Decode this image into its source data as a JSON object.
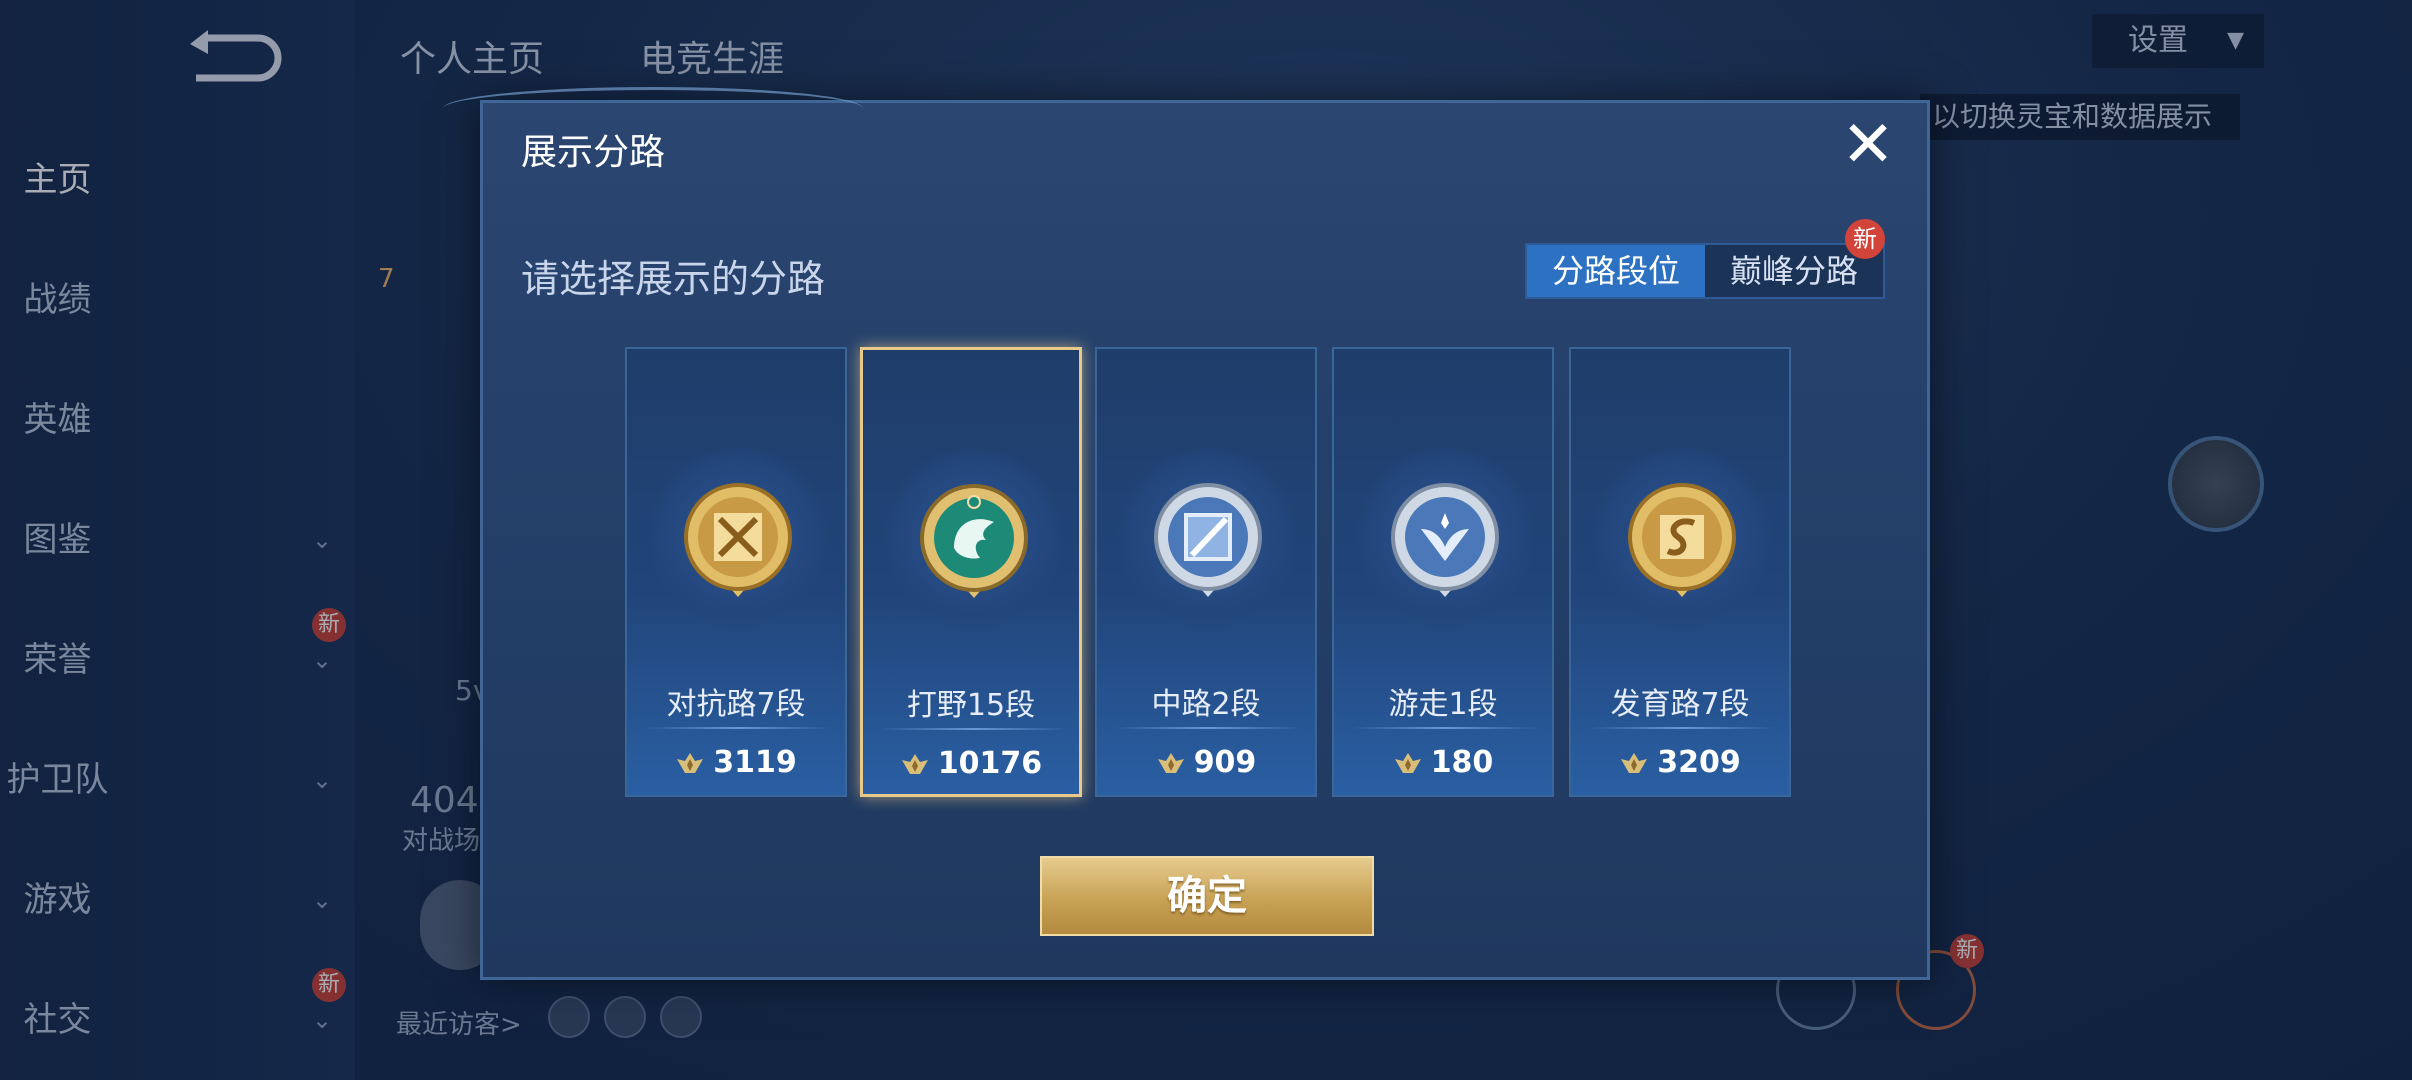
{
  "background": {
    "sidebar": [
      {
        "label": "主页",
        "active": true,
        "chevron": false,
        "new": false
      },
      {
        "label": "战绩",
        "active": false,
        "chevron": false,
        "new": false
      },
      {
        "label": "英雄",
        "active": false,
        "chevron": false,
        "new": false
      },
      {
        "label": "图鉴",
        "active": false,
        "chevron": true,
        "new": false
      },
      {
        "label": "荣誉",
        "active": false,
        "chevron": true,
        "new": true
      },
      {
        "label": "护卫队",
        "active": false,
        "chevron": true,
        "new": false
      },
      {
        "label": "游戏",
        "active": false,
        "chevron": true,
        "new": false
      },
      {
        "label": "社交",
        "active": false,
        "chevron": true,
        "new": true
      }
    ],
    "new_badge": "新",
    "top_tabs": [
      "个人主页",
      "电竞生涯"
    ],
    "settings_label": "设置",
    "hint_text": "以切换灵宝和数据展示",
    "stat_partial": "404",
    "stat_partial_label": "对战场",
    "text_partial": "5v",
    "level_partial": "7",
    "visitors_label": "最近访客>"
  },
  "modal": {
    "title": "展示分路",
    "close_label": "✕",
    "subtitle": "请选择展示的分路",
    "toggle": {
      "options": [
        "分路段位",
        "巅峰分路"
      ],
      "active_index": 0,
      "new_badge": "新"
    },
    "lanes": [
      {
        "name": "对抗路7段",
        "score": "3119",
        "badge": "shield-swords-icon",
        "color": "gold",
        "selected": false
      },
      {
        "name": "打野15段",
        "score": "10176",
        "badge": "dragon-icon",
        "color": "jade",
        "selected": true
      },
      {
        "name": "中路2段",
        "score": "909",
        "badge": "staff-icon",
        "color": "silver",
        "selected": false
      },
      {
        "name": "游走1段",
        "score": "180",
        "badge": "wings-icon",
        "color": "silver",
        "selected": false
      },
      {
        "name": "发育路7段",
        "score": "3209",
        "badge": "bow-icon",
        "color": "gold",
        "selected": false
      }
    ],
    "confirm_label": "确定"
  },
  "colors": {
    "gold": "#d8b25e",
    "jade": "#1f8f7d",
    "silver": "#b9c8dc",
    "toggle_active": "#2d72c2"
  }
}
